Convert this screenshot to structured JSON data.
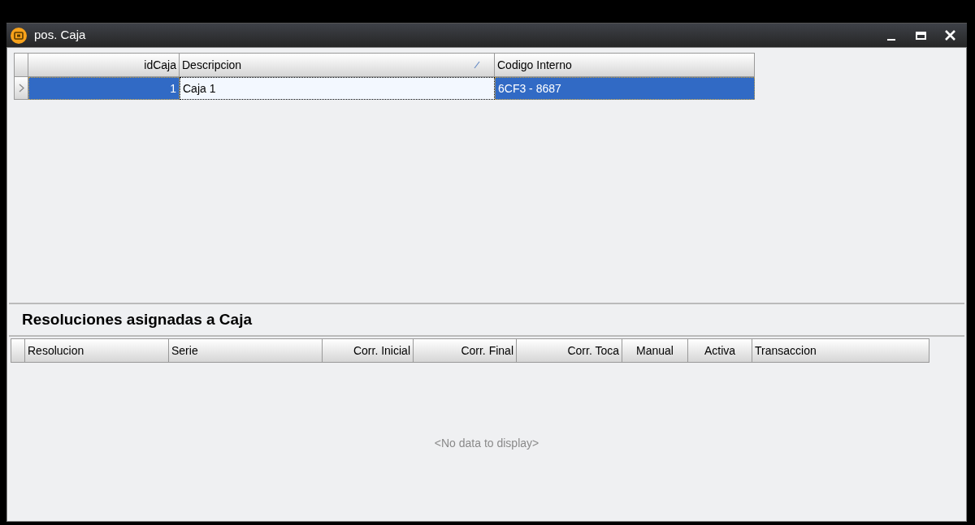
{
  "window": {
    "title": "pos. Caja"
  },
  "cajas_table": {
    "columns": [
      {
        "label": "idCaja",
        "sorted": false
      },
      {
        "label": "Descripcion",
        "sorted": true
      },
      {
        "label": "Codigo Interno",
        "sorted": false
      }
    ],
    "rows": [
      {
        "selected": true,
        "cells": [
          "1",
          "Caja 1",
          "6CF3 - 8687"
        ]
      }
    ]
  },
  "resoluciones": {
    "title": "Resoluciones asignadas a Caja",
    "columns": [
      "Resolucion",
      "Serie",
      "Corr. Inicial",
      "Corr. Final",
      "Corr. Toca",
      "Manual",
      "Activa",
      "Transaccion"
    ],
    "empty_text": "<No data to display>"
  }
}
